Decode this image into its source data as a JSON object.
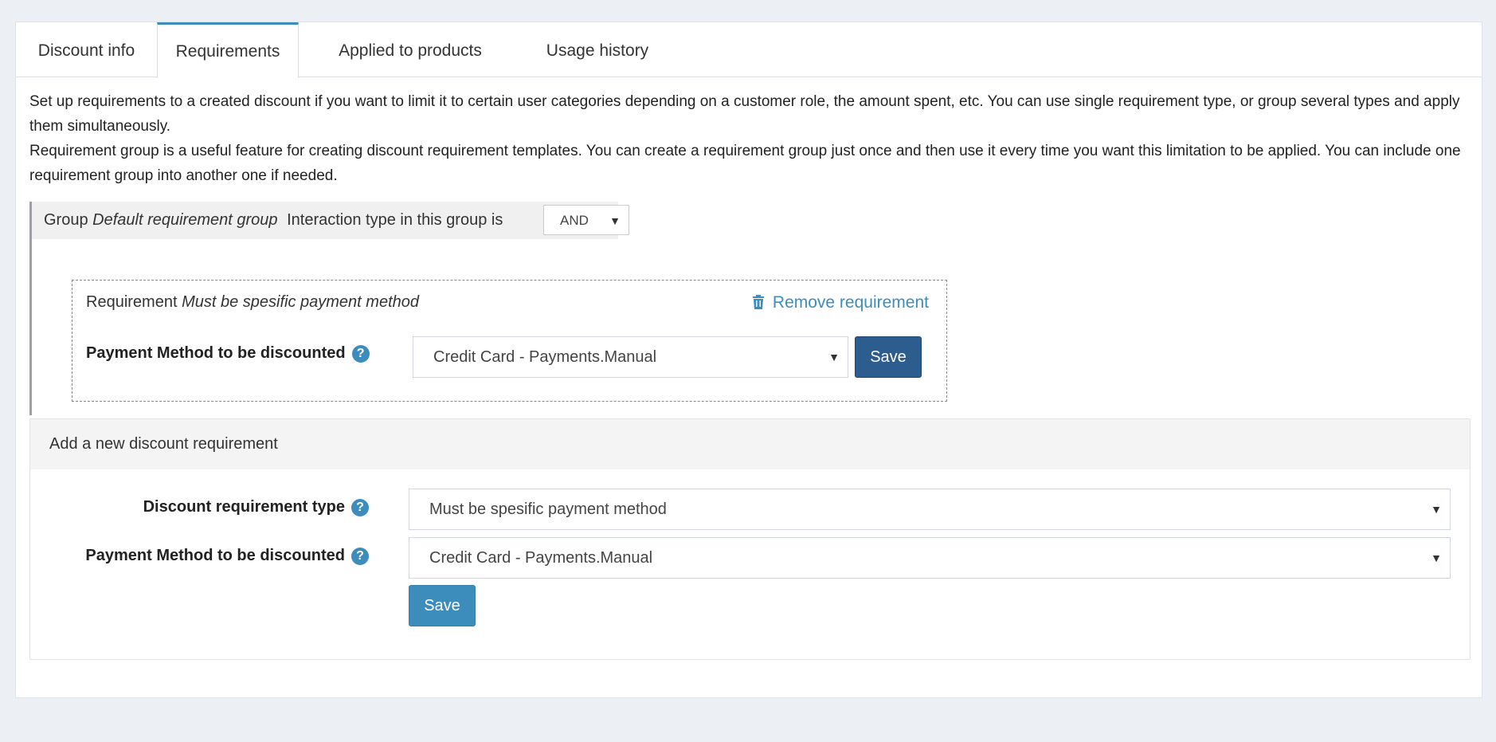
{
  "tabs": [
    {
      "label": "Discount info"
    },
    {
      "label": "Requirements"
    },
    {
      "label": "Applied to products"
    },
    {
      "label": "Usage history"
    }
  ],
  "description": {
    "line1": "Set up requirements to a created discount if you want to limit it to certain user categories depending on a customer role, the amount spent, etc. You can use single requirement type, or group several types and apply them simultaneously.",
    "line2": "Requirement group is a useful feature for creating discount requirement templates. You can create a requirement group just once and then use it every time you want this limitation to be applied. You can include one requirement group into another one if needed."
  },
  "group": {
    "prefix": "Group",
    "name": "Default requirement group",
    "interaction_label": "Interaction type in this group is",
    "interaction_value": "AND"
  },
  "requirement": {
    "prefix": "Requirement",
    "name": "Must be spesific payment method",
    "remove_label": "Remove requirement",
    "field_label": "Payment Method to be discounted",
    "field_value": "Credit Card - Payments.Manual",
    "save_label": "Save"
  },
  "add_requirement": {
    "title": "Add a new discount requirement",
    "type_label": "Discount requirement type",
    "type_value": "Must be spesific payment method",
    "payment_label": "Payment Method to be discounted",
    "payment_value": "Credit Card - Payments.Manual",
    "save_label": "Save"
  },
  "colors": {
    "accent": "#3c8dbc",
    "dark_button": "#2d5c8e",
    "background": "#ecf0f5"
  },
  "icons": {
    "help": "question-circle-icon",
    "trash": "trash-icon",
    "dropdown": "caret-down-icon"
  }
}
